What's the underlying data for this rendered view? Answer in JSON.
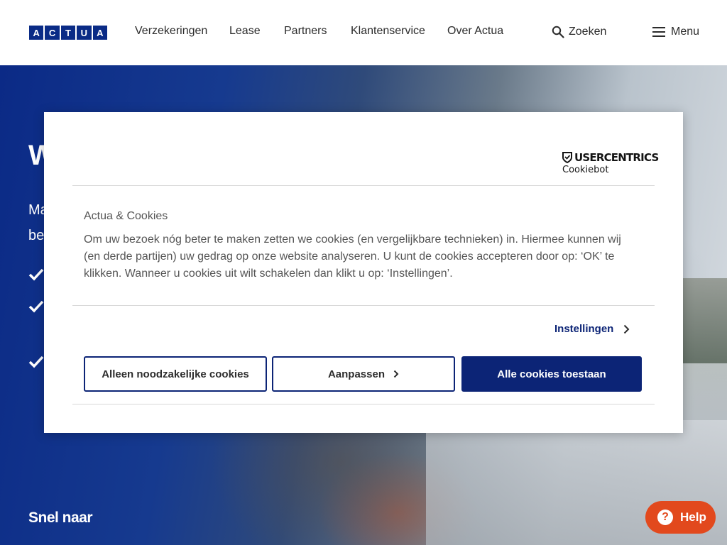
{
  "header": {
    "logo_letters": [
      "A",
      "C",
      "T",
      "U",
      "A"
    ],
    "nav": [
      {
        "label": "Verzekeringen"
      },
      {
        "label": "Lease"
      },
      {
        "label": "Partners"
      },
      {
        "label": "Klantenservice"
      },
      {
        "label": "Over Actua"
      }
    ],
    "search_label": "Zoeken",
    "menu_label": "Menu"
  },
  "hero": {
    "title": "W",
    "subtitle_line1": "Ma",
    "subtitle_line2": "be",
    "quick_links_label": "Snel naar"
  },
  "cookie_dialog": {
    "brand_name": "USERCENTRICS",
    "brand_sub": "Cookiebot",
    "title": "Actua & Cookies",
    "body": "Om uw bezoek nóg beter te maken zetten we cookies (en vergelijkbare technieken) in. Hiermee kunnen wij (en derde partijen) uw gedrag op onze website analyseren. U kunt de cookies accepteren door op: ‘OK’ te klikken. Wanneer u cookies uit wilt schakelen dan klikt u op: ‘Instellingen’.",
    "settings_label": "Instellingen",
    "btn_necessary": "Alleen noodzakelijke cookies",
    "btn_customize": "Aanpassen",
    "btn_accept_all": "Alle cookies toestaan"
  },
  "help": {
    "label": "Help"
  },
  "colors": {
    "brand_blue": "#0a2b86",
    "button_blue": "#0c2476",
    "help_orange": "#e2491d"
  },
  "icons": [
    "search-icon",
    "hamburger-icon",
    "check-icon",
    "chevron-right-icon",
    "shield-icon",
    "question-icon"
  ]
}
